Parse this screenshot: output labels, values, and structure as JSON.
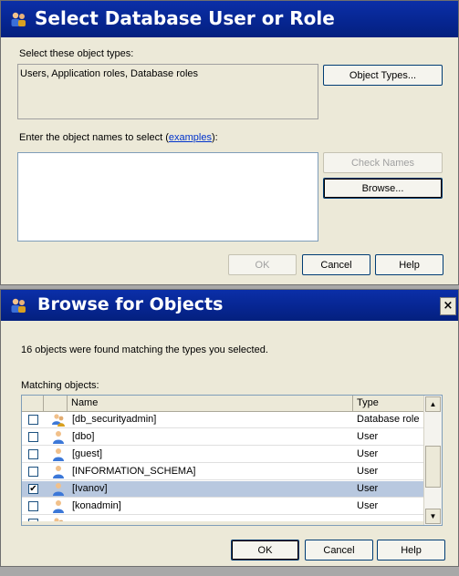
{
  "dialog1": {
    "title": "Select Database User or Role",
    "object_types_label": "Select these object types:",
    "object_types_value": "Users, Application roles, Database roles",
    "object_types_button": "Object Types...",
    "names_label_prefix": "Enter the object names to select (",
    "names_label_link": "examples",
    "names_label_suffix": "):",
    "names_value": "",
    "check_names_button": "Check Names",
    "browse_button": "Browse...",
    "ok_button": "OK",
    "cancel_button": "Cancel",
    "help_button": "Help",
    "close_glyph": "×"
  },
  "dialog2": {
    "title": "Browse for Objects",
    "found_text": "16 objects were found matching the types you selected.",
    "matching_label": "Matching objects:",
    "columns": {
      "name": "Name",
      "type": "Type"
    },
    "rows": [
      {
        "name": "[db_securityadmin]",
        "type": "Database role",
        "checked": false,
        "selected": false,
        "icon": "role-icon"
      },
      {
        "name": "[dbo]",
        "type": "User",
        "checked": false,
        "selected": false,
        "icon": "user-icon"
      },
      {
        "name": "[guest]",
        "type": "User",
        "checked": false,
        "selected": false,
        "icon": "user-icon"
      },
      {
        "name": "[INFORMATION_SCHEMA]",
        "type": "User",
        "checked": false,
        "selected": false,
        "icon": "user-icon"
      },
      {
        "name": "[Ivanov]",
        "type": "User",
        "checked": true,
        "selected": true,
        "icon": "user-icon"
      },
      {
        "name": "[konadmin]",
        "type": "User",
        "checked": false,
        "selected": false,
        "icon": "user-icon"
      },
      {
        "name": "",
        "type": "",
        "checked": false,
        "selected": false,
        "icon": "role-icon"
      }
    ],
    "ok_button": "OK",
    "cancel_button": "Cancel",
    "help_button": "Help",
    "close_glyph": "×",
    "scroll_up_glyph": "▲",
    "scroll_down_glyph": "▼",
    "check_glyph": "✔"
  },
  "colors": {
    "titlebar": "#062590",
    "dialog_bg": "#ece9d8",
    "selected_row": "#b8c8df",
    "link": "#0033cc"
  }
}
